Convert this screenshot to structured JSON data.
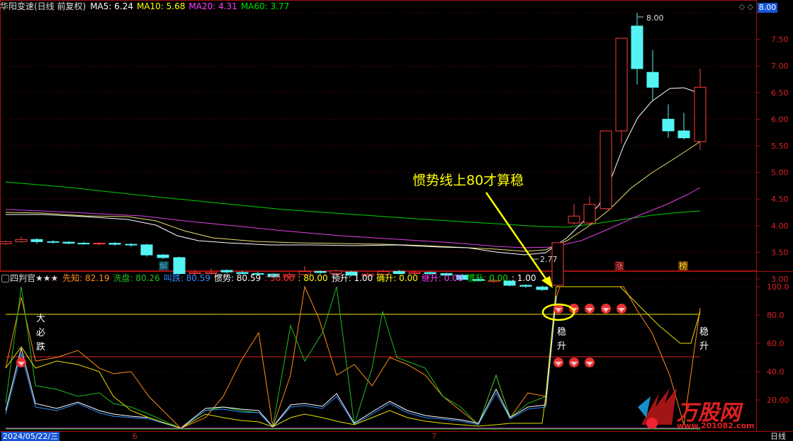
{
  "stock": {
    "name": "华阳变速(日线 前复权)"
  },
  "ma_legend": [
    {
      "label": "MA5: 6.24",
      "color": "#ffffff"
    },
    {
      "label": "MA10: 5.68",
      "color": "#ffff00"
    },
    {
      "label": "MA20: 4.31",
      "color": "#ff40ff"
    },
    {
      "label": "MA60: 3.77",
      "color": "#00e000"
    }
  ],
  "price_axis": [
    "8.00",
    "7.50",
    "7.00",
    "6.50",
    "6.00",
    "5.50",
    "5.00",
    "4.50",
    "4.00",
    "3.50",
    "3.00"
  ],
  "current_price_label": "8.00",
  "high_label": "8.00",
  "low_label": "2.77",
  "signals": {
    "jie": "解",
    "zhang": "涨",
    "bang": "榜"
  },
  "annotation": "惯势线上80才算稳",
  "indicator": {
    "name": "四判官★★★",
    "legend": [
      {
        "label": "先知: 82.19",
        "color": "#ff8c1a"
      },
      {
        "label": "洗盘: 80.26",
        "color": "#1ebc1e"
      },
      {
        "label": "叫跌: 80.59",
        "color": "#2f8cff"
      },
      {
        "label": "惯势: 80.59",
        "color": "#ffffff"
      },
      {
        "label": ": 50.00",
        "color": "#ff3030"
      },
      {
        "label": ": 80.00",
        "color": "#ffff00"
      },
      {
        "label": "预升: 1.00",
        "color": "#ffffff"
      },
      {
        "label": "确升: 0.00",
        "color": "#ffff00"
      },
      {
        "label": "继升: 0.00",
        "color": "#ff40ff"
      },
      {
        "label": "惯升: 0.00",
        "color": "#00e000"
      },
      {
        "label": ": 1.00",
        "color": "#ffffff"
      }
    ],
    "axis": [
      "100.0",
      "80.0",
      "60.0",
      "40.0",
      "20.00"
    ],
    "texts": {
      "da": "大",
      "bi": "必",
      "die": "跌",
      "wen1": "稳",
      "sheng1": "升",
      "wen2": "稳",
      "sheng2": "升"
    }
  },
  "date_bar": {
    "start": "2024/05/22/三",
    "m6": "6",
    "m7": "7",
    "period": "日线"
  },
  "watermark": {
    "brand": "万股网",
    "url": "www.201082.com"
  }
}
